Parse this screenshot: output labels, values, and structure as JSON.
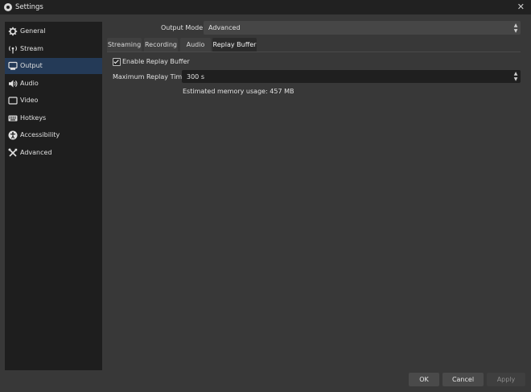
{
  "window": {
    "title": "Settings",
    "close_glyph": "✕"
  },
  "sidebar": {
    "items": [
      {
        "label": "General",
        "icon": "gear-icon",
        "active": false
      },
      {
        "label": "Stream",
        "icon": "antenna-icon",
        "active": false
      },
      {
        "label": "Output",
        "icon": "output-icon",
        "active": true
      },
      {
        "label": "Audio",
        "icon": "speaker-icon",
        "active": false
      },
      {
        "label": "Video",
        "icon": "monitor-icon",
        "active": false
      },
      {
        "label": "Hotkeys",
        "icon": "keyboard-icon",
        "active": false
      },
      {
        "label": "Accessibility",
        "icon": "accessibility-icon",
        "active": false
      },
      {
        "label": "Advanced",
        "icon": "tools-icon",
        "active": false
      }
    ],
    "active_color": "#243a57"
  },
  "output_mode": {
    "label": "Output Mode",
    "value": "Advanced"
  },
  "tabs": [
    {
      "label": "Streaming",
      "active": false
    },
    {
      "label": "Recording",
      "active": false
    },
    {
      "label": "Audio",
      "active": false
    },
    {
      "label": "Replay Buffer",
      "active": true
    }
  ],
  "replay_buffer": {
    "enable_label": "Enable Replay Buffer",
    "enable_checked": true,
    "max_time_label": "Maximum Replay Time",
    "max_time_value": "300 s",
    "memory_text": "Estimated memory usage: 457 MB"
  },
  "buttons": {
    "ok": "OK",
    "cancel": "Cancel",
    "apply": "Apply",
    "apply_enabled": false
  },
  "spin_glyphs": {
    "up": "▲",
    "down": "▼"
  }
}
